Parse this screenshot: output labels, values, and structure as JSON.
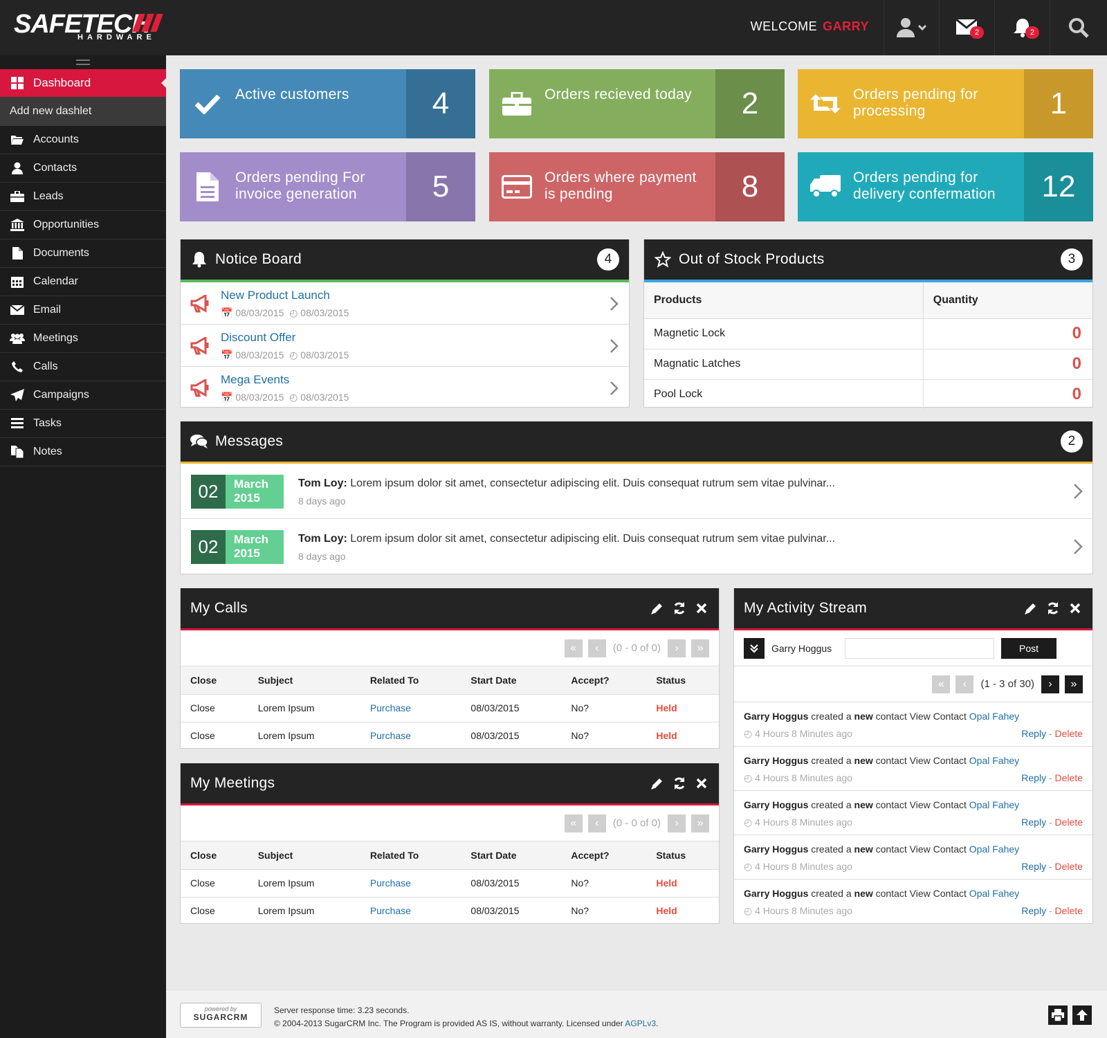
{
  "brand": {
    "name": "SAFETECH",
    "sub": "HARDWARE"
  },
  "header": {
    "welcome": "WELCOME",
    "user": "GARRY",
    "mail_count": "2",
    "alert_count": "2"
  },
  "sidebar": {
    "active": "Dashboard",
    "add": "Add new dashlet",
    "items": [
      {
        "label": "Accounts",
        "icon": "folder-open-icon"
      },
      {
        "label": "Contacts",
        "icon": "user-icon"
      },
      {
        "label": "Leads",
        "icon": "briefcase-icon"
      },
      {
        "label": "Opportunities",
        "icon": "bank-icon"
      },
      {
        "label": "Documents",
        "icon": "document-icon"
      },
      {
        "label": "Calendar",
        "icon": "calendar-icon"
      },
      {
        "label": "Email",
        "icon": "envelope-icon"
      },
      {
        "label": "Meetings",
        "icon": "group-icon"
      },
      {
        "label": "Calls",
        "icon": "phone-icon"
      },
      {
        "label": "Campaigns",
        "icon": "paper-plane-icon"
      },
      {
        "label": "Tasks",
        "icon": "list-icon"
      },
      {
        "label": "Notes",
        "icon": "files-icon"
      }
    ]
  },
  "tiles": [
    {
      "label": "Active customers",
      "value": "4",
      "color": "#4589b8",
      "dark": "#356f96",
      "icon": "check-icon"
    },
    {
      "label": "Orders recieved today",
      "value": "2",
      "color": "#84ae5d",
      "dark": "#6b8e4b",
      "icon": "briefcase-icon"
    },
    {
      "label": "Orders pending for processing",
      "value": "1",
      "color": "#eab530",
      "dark": "#c8982a",
      "icon": "retweet-icon"
    },
    {
      "label": "Orders pending For invoice generation",
      "value": "5",
      "color": "#a28dca",
      "dark": "#8775ab",
      "icon": "document-icon"
    },
    {
      "label": "Orders where payment is pending",
      "value": "8",
      "color": "#cd6567",
      "dark": "#ad5153",
      "icon": "credit-card-icon"
    },
    {
      "label": "Orders pending for delivery confermation",
      "value": "12",
      "color": "#20aab9",
      "dark": "#1a8e99",
      "icon": "truck-icon"
    }
  ],
  "notice_board": {
    "title": "Notice Board",
    "count": "4",
    "accent": "#5cb85c",
    "items": [
      {
        "title": "New Product Launch",
        "start": "08/03/2015",
        "end": "08/03/2015"
      },
      {
        "title": "Discount Offer",
        "start": "08/03/2015",
        "end": "08/03/2015"
      },
      {
        "title": "Mega Events",
        "start": "08/03/2015",
        "end": "08/03/2015"
      }
    ]
  },
  "out_of_stock": {
    "title": "Out of Stock Products",
    "count": "3",
    "accent": "#3aa3e3",
    "columns": [
      "Products",
      "Quantity"
    ],
    "rows": [
      {
        "product": "Magnetic Lock",
        "qty": "0"
      },
      {
        "product": "Magnatic Latches",
        "qty": "0"
      },
      {
        "product": "Pool Lock",
        "qty": "0"
      }
    ]
  },
  "messages": {
    "title": "Messages",
    "count": "2",
    "accent": "#eab530",
    "items": [
      {
        "day": "02",
        "month": "March",
        "year": "2015",
        "author": "Tom Loy:",
        "text": "Lorem ipsum dolor sit amet, consectetur adipiscing elit. Duis consequat rutrum sem vitae pulvinar...",
        "ago": "8 days ago"
      },
      {
        "day": "02",
        "month": "March",
        "year": "2015",
        "author": "Tom Loy:",
        "text": "Lorem ipsum dolor sit amet, consectetur adipiscing elit. Duis consequat rutrum sem vitae pulvinar...",
        "ago": "8 days ago"
      }
    ]
  },
  "my_calls": {
    "title": "My Calls",
    "pager": "(0 - 0 of 0)",
    "columns": [
      "Close",
      "Subject",
      "Related To",
      "Start Date",
      "Accept?",
      "Status"
    ],
    "rows": [
      {
        "close": "Close",
        "subject": "Lorem Ipsum",
        "related": "Purchase",
        "date": "08/03/2015",
        "accept": "No?",
        "status": "Held"
      },
      {
        "close": "Close",
        "subject": "Lorem Ipsum",
        "related": "Purchase",
        "date": "08/03/2015",
        "accept": "No?",
        "status": "Held"
      }
    ]
  },
  "my_meetings": {
    "title": "My Meetings",
    "pager": "(0 - 0 of 0)",
    "columns": [
      "Close",
      "Subject",
      "Related To",
      "Start Date",
      "Accept?",
      "Status"
    ],
    "rows": [
      {
        "close": "Close",
        "subject": "Lorem Ipsum",
        "related": "Purchase",
        "date": "08/03/2015",
        "accept": "No?",
        "status": "Held"
      },
      {
        "close": "Close",
        "subject": "Lorem Ipsum",
        "related": "Purchase",
        "date": "08/03/2015",
        "accept": "No?",
        "status": "Held"
      }
    ]
  },
  "activity": {
    "title": "My Activity Stream",
    "user": "Garry Hoggus",
    "post_label": "Post",
    "pager": "(1 - 3 of 30)",
    "items": [
      {
        "user": "Garry Hoggus",
        "verb": "created a",
        "bold": "new",
        "rest": "contact View Contact",
        "link": "Opal Fahey",
        "ago": "4 Hours 8 Minutes ago",
        "reply": "Reply",
        "sep": "-",
        "delete": "Delete"
      },
      {
        "user": "Garry Hoggus",
        "verb": "created a",
        "bold": "new",
        "rest": "contact View Contact",
        "link": "Opal Fahey",
        "ago": "4 Hours 8 Minutes ago",
        "reply": "Reply",
        "sep": "-",
        "delete": "Delete"
      },
      {
        "user": "Garry Hoggus",
        "verb": "created a",
        "bold": "new",
        "rest": "contact View Contact",
        "link": "Opal Fahey",
        "ago": "4 Hours 8 Minutes ago",
        "reply": "Reply",
        "sep": "-",
        "delete": "Delete"
      },
      {
        "user": "Garry Hoggus",
        "verb": "created a",
        "bold": "new",
        "rest": "contact View Contact",
        "link": "Opal Fahey",
        "ago": "4 Hours 8 Minutes ago",
        "reply": "Reply",
        "sep": "-",
        "delete": "Delete"
      },
      {
        "user": "Garry Hoggus",
        "verb": "created a",
        "bold": "new",
        "rest": "contact View Contact",
        "link": "Opal Fahey",
        "ago": "4 Hours 8 Minutes ago",
        "reply": "Reply",
        "sep": "-",
        "delete": "Delete"
      }
    ]
  },
  "footer": {
    "powered_by": "powered by",
    "powered_brand": "SUGARCRM",
    "response": "Server response time: 3.23 seconds.",
    "copyright": "© 2004-2013 SugarCRM Inc. The Program is provided AS IS, without warranty. Licensed under",
    "license": "AGPLv3",
    "license_end": "."
  },
  "colors": {
    "brand_red": "#d8173e",
    "header_bg": "#242424",
    "sidebar_bg": "#1c1c1c",
    "link": "#1f6fa6",
    "held": "#e74c3c"
  }
}
